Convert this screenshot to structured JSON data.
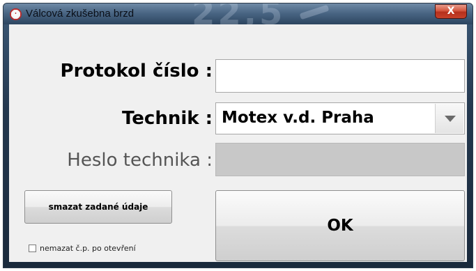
{
  "window": {
    "title": "Válcová zkušebna brzd",
    "title_background_number": "22,5",
    "close_glyph": "X"
  },
  "form": {
    "protokol_label": "Protokol číslo :",
    "protokol_value": "",
    "technik_label": "Technik :",
    "technik_selected": "Motex v.d. Praha",
    "heslo_label": "Heslo technika :",
    "heslo_value": ""
  },
  "buttons": {
    "clear_label": "smazat zadané údaje",
    "ok_label": "OK"
  },
  "checkbox": {
    "label": "nemazat č.p. po otevření",
    "checked": false
  },
  "icons": {
    "app": "app-logo-icon",
    "close": "close-icon",
    "dropdown": "chevron-down-icon",
    "checkbox": "checkbox-icon"
  },
  "colors": {
    "close_button": "#c8412a",
    "client_background": "#f0f0f0",
    "disabled_field": "#c8c8c8"
  }
}
